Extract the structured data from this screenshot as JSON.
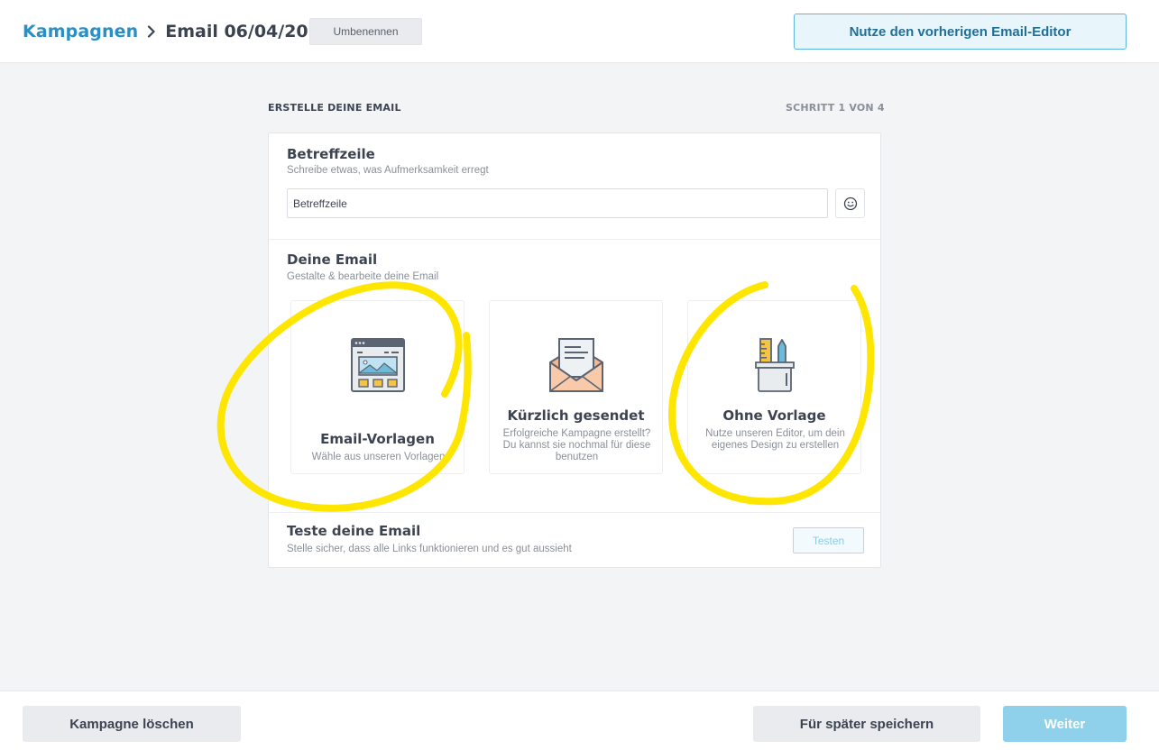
{
  "header": {
    "breadcrumb_root": "Kampagnen",
    "breadcrumb_current": "Email 06/04/20",
    "rename_label": "Umbenennen",
    "old_editor_label": "Nutze den vorherigen Email-Editor"
  },
  "steps": {
    "title": "ERSTELLE DEINE EMAIL",
    "progress": "SCHRITT 1 VON 4"
  },
  "subject": {
    "title": "Betreffzeile",
    "subtitle": "Schreibe etwas, was Aufmerksamkeit erregt",
    "value": "Betreffzeile"
  },
  "email": {
    "title": "Deine Email",
    "subtitle": "Gestalte & bearbeite deine Email",
    "options": [
      {
        "title": "Email-Vorlagen",
        "desc": "Wähle aus unseren Vorlagen",
        "icon": "template-browser-icon"
      },
      {
        "title": "Kürzlich gesendet",
        "desc": "Erfolgreiche Kampagne erstellt? Du kannst sie nochmal für diese benutzen",
        "icon": "open-envelope-icon"
      },
      {
        "title": "Ohne Vorlage",
        "desc": "Nutze unseren Editor, um dein eigenes Design zu erstellen",
        "icon": "pencil-cup-icon"
      }
    ]
  },
  "test": {
    "title": "Teste deine Email",
    "subtitle": "Stelle sicher, dass alle Links funktionieren und es gut aussieht",
    "button_label": "Testen"
  },
  "footer": {
    "delete_label": "Kampagne löschen",
    "save_later_label": "Für später speichern",
    "next_label": "Weiter"
  },
  "colors": {
    "accent": "#2a8fc6",
    "highlight_marker": "#ffe600"
  }
}
